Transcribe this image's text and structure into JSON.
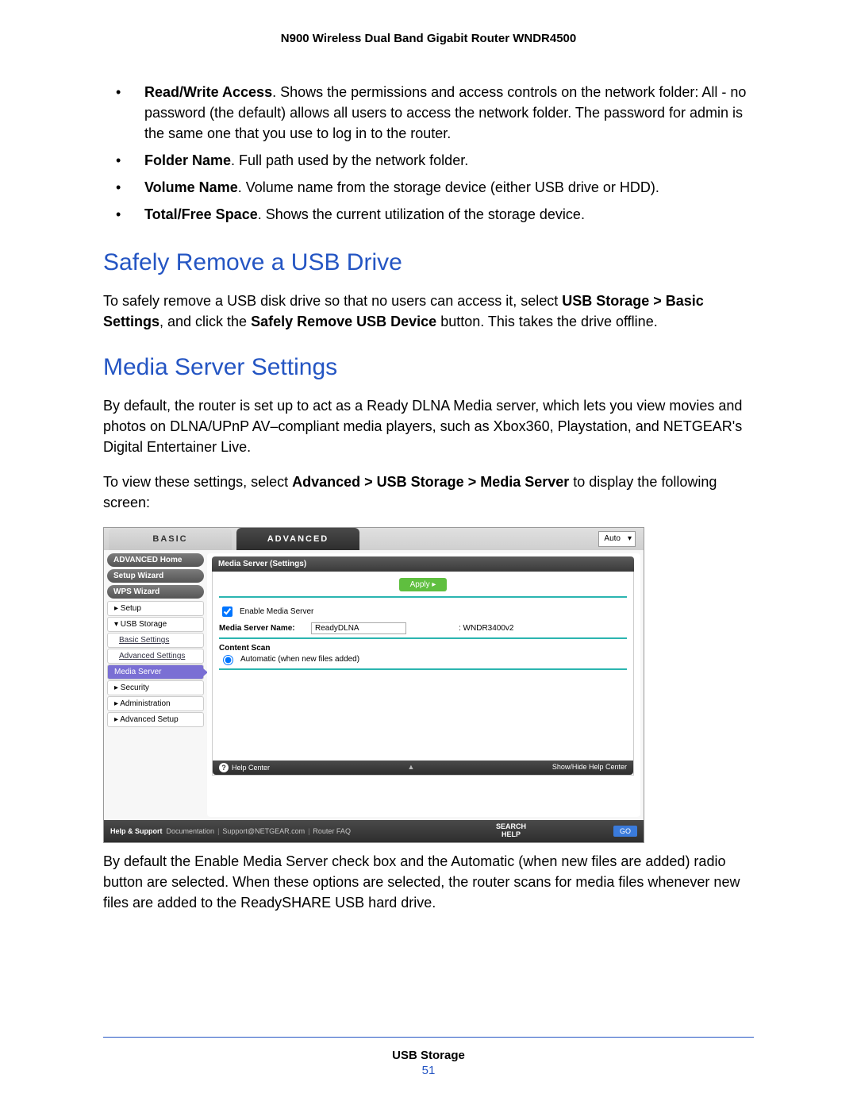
{
  "doc_title": "N900 Wireless Dual Band Gigabit Router WNDR4500",
  "bullets": [
    {
      "term": "Read/Write Access",
      "rest": ". Shows the permissions and access controls on the network folder: All - no password (the default) allows all users to access the network folder. The password for admin is the same one that you use to log in to the router."
    },
    {
      "term": "Folder Name",
      "rest": ". Full path used by the network folder."
    },
    {
      "term": "Volume Name",
      "rest": ". Volume name from the storage device (either USB drive or HDD)."
    },
    {
      "term": "Total/Free Space",
      "rest": ". Shows the current utilization of the storage device."
    }
  ],
  "h_safely": "Safely Remove a USB Drive",
  "p_safely_1a": "To safely remove a USB disk drive so that no users can access it, select ",
  "p_safely_1b": "USB Storage > Basic Settings",
  "p_safely_1c": ", and click the ",
  "p_safely_1d": "Safely Remove USB Device",
  "p_safely_1e": " button. This takes the drive offline.",
  "h_media": "Media Server Settings",
  "p_media_1": "By default, the router is set up to act as a Ready DLNA Media server, which lets you view movies and photos on DLNA/UPnP AV–compliant media players, such as Xbox360, Playstation, and NETGEAR's Digital Entertainer Live.",
  "p_media_2a": "To view these settings, select ",
  "p_media_2b": "Advanced > USB Storage > Media Server",
  "p_media_2c": " to display the following screen:",
  "p_media_3": "By default the Enable Media Server check box and the Automatic (when new files are added) radio button are selected. When these options are selected, the router scans for media files whenever new files are added to the ReadySHARE USB hard drive.",
  "shot": {
    "tab_basic": "BASIC",
    "tab_adv": "ADVANCED",
    "auto": "Auto",
    "side": {
      "adv_home": "ADVANCED Home",
      "setup_wiz": "Setup Wizard",
      "wps_wiz": "WPS Wizard",
      "setup": "▸ Setup",
      "usb": "▾ USB Storage",
      "basic_set": "Basic Settings",
      "adv_set": "Advanced Settings",
      "media": "Media Server",
      "security": "▸ Security",
      "admin": "▸ Administration",
      "adv_setup": "▸ Advanced Setup"
    },
    "panel_title": "Media Server (Settings)",
    "apply": "Apply ▸",
    "enable_label": "Enable Media Server",
    "name_label": "Media Server Name:",
    "name_value": "ReadyDLNA",
    "device_suffix": ": WNDR3400v2",
    "scan_label": "Content Scan",
    "scan_option": "Automatic (when new files added)",
    "help_center": "Help Center",
    "show_hide": "Show/Hide Help Center",
    "footer_label": "Help & Support",
    "footer_doc": "Documentation",
    "footer_support": "Support@NETGEAR.com",
    "footer_faq": "Router FAQ",
    "search_help": "SEARCH HELP",
    "go": "GO"
  },
  "footer_section": "USB Storage",
  "page_number": "51"
}
